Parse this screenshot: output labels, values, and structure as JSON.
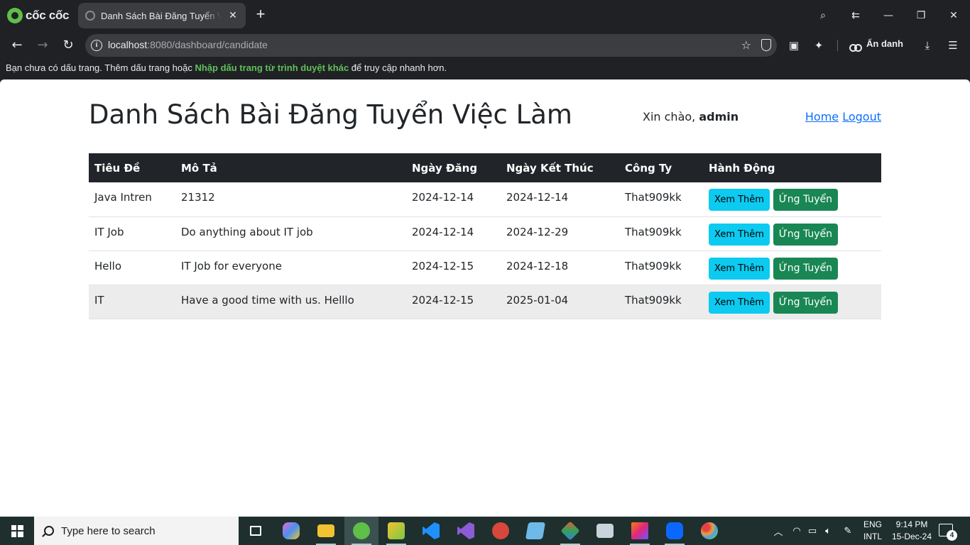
{
  "browser": {
    "brand_name": "cốc cốc",
    "tab_title": "Danh Sách Bài Đăng Tuyển Việc Làm",
    "url_host": "localhost",
    "url_rest": ":8080/dashboard/candidate",
    "incognito_label": "Ẩn danh",
    "bookmark_bar": {
      "text_before": "Bạn chưa có dấu trang. Thêm dấu trang hoặc ",
      "link": "Nhập dấu trang từ trình duyệt khác",
      "text_after": " để truy cập nhanh hơn."
    }
  },
  "page": {
    "title": "Danh Sách Bài Đăng Tuyển Việc Làm",
    "greeting_prefix": "Xin chào, ",
    "username": "admin",
    "nav": {
      "home": "Home",
      "logout": "Logout"
    },
    "table": {
      "headers": [
        "Tiêu Đề",
        "Mô Tả",
        "Ngày Đăng",
        "Ngày Kết Thúc",
        "Công Ty",
        "Hành Động"
      ],
      "rows": [
        {
          "title": "Java Intren",
          "description": "21312",
          "posted": "2024-12-14",
          "ends": "2024-12-14",
          "company": "That909kk"
        },
        {
          "title": "IT Job",
          "description": "Do anything about IT job",
          "posted": "2024-12-14",
          "ends": "2024-12-29",
          "company": "That909kk"
        },
        {
          "title": "Hello",
          "description": "IT Job for everyone",
          "posted": "2024-12-15",
          "ends": "2024-12-18",
          "company": "That909kk"
        },
        {
          "title": "IT",
          "description": "Have a good time with us. Helllo",
          "posted": "2024-12-15",
          "ends": "2025-01-04",
          "company": "That909kk"
        }
      ],
      "view_more_label": "Xem Thêm",
      "apply_label": "Ứng Tuyển"
    }
  },
  "taskbar": {
    "search_placeholder": "Type here to search",
    "lang_line1": "ENG",
    "lang_line2": "INTL",
    "time": "9:14 PM",
    "date": "15-Dec-24",
    "notification_count": "4",
    "apps": [
      {
        "name": "task-view",
        "color": "#ffffff"
      },
      {
        "name": "copilot",
        "color": "#e86bd0"
      },
      {
        "name": "file-explorer",
        "color": "#f2c230"
      },
      {
        "name": "coccoc",
        "color": "#5fbf49"
      },
      {
        "name": "image-tool",
        "color": "#7ac943"
      },
      {
        "name": "vscode",
        "color": "#1e90ff"
      },
      {
        "name": "visual-studio",
        "color": "#8e5bd6"
      },
      {
        "name": "sapphire-app",
        "color": "#d8473b"
      },
      {
        "name": "notepad",
        "color": "#6fb9e8"
      },
      {
        "name": "git-app",
        "color": "#e85a30"
      },
      {
        "name": "photos",
        "color": "#c9d3dc"
      },
      {
        "name": "intellij",
        "color": "#e0267c"
      },
      {
        "name": "zalo",
        "color": "#0a68ff"
      },
      {
        "name": "paint",
        "color": "#e8a040"
      }
    ],
    "colors": {
      "taskbar": "#1e2f2e",
      "active": "#3b5150"
    }
  },
  "colors": {
    "table_header": "#212529",
    "btn_info": "#0dcaf0",
    "btn_success": "#198754",
    "link": "#0d6efd",
    "bookmark_link": "#5fc05a"
  }
}
